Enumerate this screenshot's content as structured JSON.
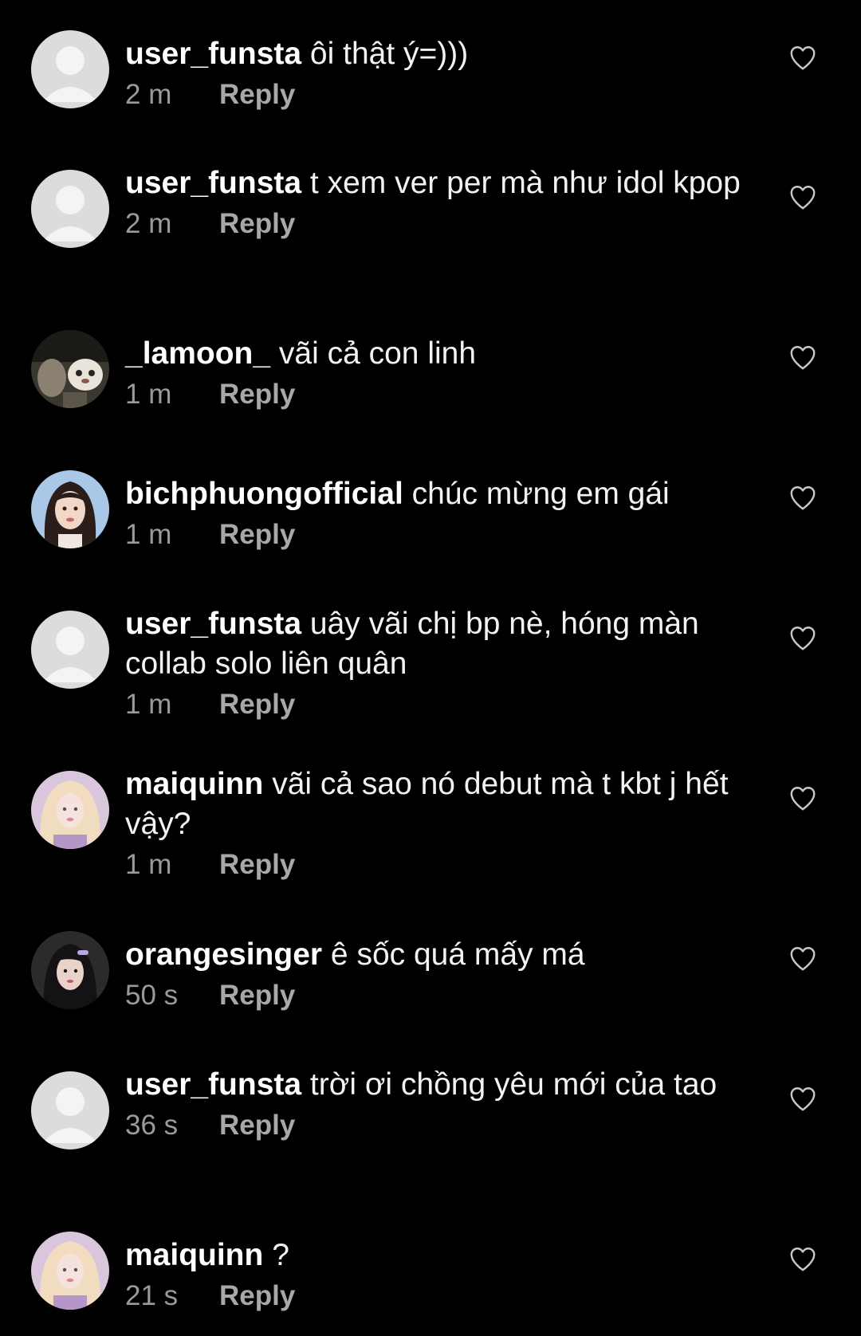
{
  "comments": [
    {
      "username": "user_funsta",
      "text": "ôi thật ý=)))",
      "time": "2 m",
      "reply_label": "Reply",
      "avatar": "default-avatar"
    },
    {
      "username": "user_funsta",
      "text": "t xem ver per mà như idol kpop",
      "time": "2 m",
      "reply_label": "Reply",
      "avatar": "default-avatar"
    },
    {
      "username": "_lamoon_",
      "text": "vãi cả con linh",
      "time": "1 m",
      "reply_label": "Reply",
      "avatar": "photo-avatar"
    },
    {
      "username": "bichphuongofficial",
      "text": "chúc mừng em gái",
      "time": "1 m",
      "reply_label": "Reply",
      "avatar": "photo-avatar"
    },
    {
      "username": "user_funsta",
      "text": "uây vãi chị bp nè, hóng màn collab solo liên quân",
      "time": "1 m",
      "reply_label": "Reply",
      "avatar": "default-avatar"
    },
    {
      "username": "maiquinn",
      "text": "vãi cả sao nó debut mà t kbt j hết vậy?",
      "time": "1 m",
      "reply_label": "Reply",
      "avatar": "photo-avatar"
    },
    {
      "username": "orangesinger",
      "text": "ê sốc quá mấy má",
      "time": "50 s",
      "reply_label": "Reply",
      "avatar": "photo-avatar"
    },
    {
      "username": "user_funsta",
      "text": "trời ơi chồng yêu mới của tao",
      "time": "36 s",
      "reply_label": "Reply",
      "avatar": "default-avatar"
    },
    {
      "username": "maiquinn",
      "text": "?",
      "time": "21 s",
      "reply_label": "Reply",
      "avatar": "photo-avatar"
    }
  ],
  "icons": {
    "like": "heart-outline-icon"
  },
  "colors": {
    "background": "#000000",
    "username": "#ffffff",
    "comment_text": "#f2f2f2",
    "meta": "#9a9a9a",
    "default_avatar_bg": "#dcdcdc",
    "default_avatar_fg": "#f4f4f4"
  }
}
